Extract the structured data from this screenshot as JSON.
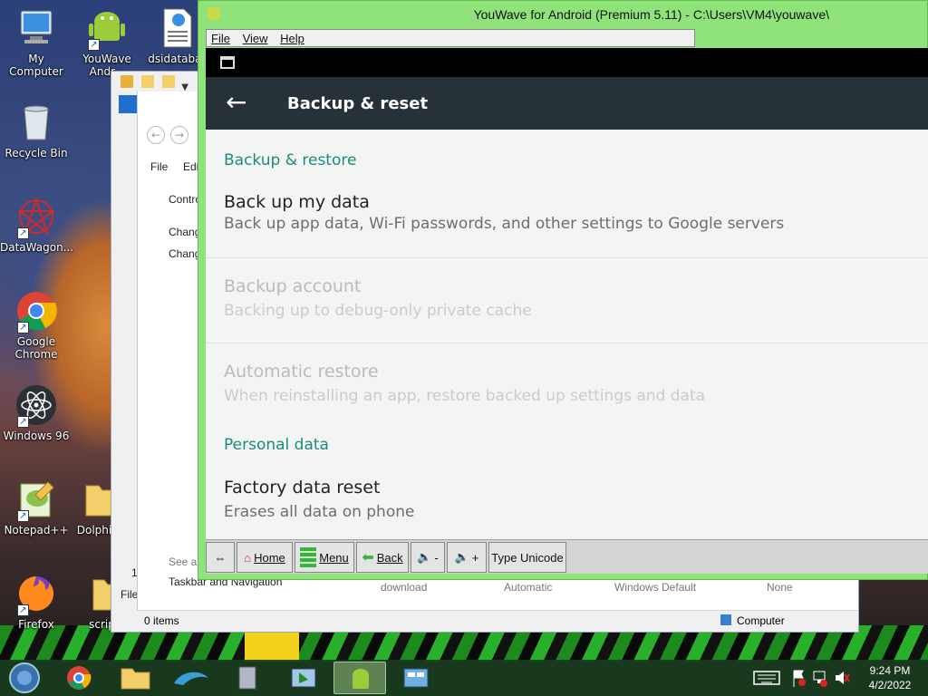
{
  "desktop": {
    "icons": [
      {
        "label": "My Computer"
      },
      {
        "label": "YouWave Andr..."
      },
      {
        "label": "dsidatabas"
      },
      {
        "label": "Recycle Bin"
      },
      {
        "label": "DataWagon..."
      },
      {
        "label": "Google Chrome"
      },
      {
        "label": "Windows 96"
      },
      {
        "label": "Notepad++"
      },
      {
        "label": "Dolphi"
      },
      {
        "label": "Firefox"
      },
      {
        "label": "scripts"
      }
    ]
  },
  "explorer": {
    "menu_file": "File",
    "menu_edit": "Edit",
    "left_file": "File",
    "item_control": "Contro",
    "item_change1": "Chang",
    "item_change2": "Chang",
    "see_also": "See als",
    "taskbar_nav": "Taskbar and Navigation",
    "row_values": [
      "download",
      "Automatic",
      "Windows Default",
      "None"
    ],
    "items_count": "0 items",
    "location": "Computer",
    "digit": "1"
  },
  "youwave": {
    "title": "YouWave for Android (Premium 5.11) - C:\\Users\\VM4\\youwave\\",
    "menu": {
      "file": "File",
      "view": "View",
      "help": "Help"
    },
    "screen": {
      "page_title": "Backup & reset",
      "section_backup": "Backup & restore",
      "section_personal": "Personal data",
      "prefs": [
        {
          "title": "Back up my data",
          "summary": "Back up app data, Wi-Fi passwords, and other settings to Google servers",
          "enabled": true
        },
        {
          "title": "Backup account",
          "summary": "Backing up to debug-only private cache",
          "enabled": false
        },
        {
          "title": "Automatic restore",
          "summary": "When reinstalling an app, restore backed up settings and data",
          "enabled": false
        },
        {
          "title": "Factory data reset",
          "summary": "Erases all data on phone",
          "enabled": true
        }
      ]
    },
    "toolbar": {
      "home": "Home",
      "menu": "Menu",
      "back": "Back",
      "vol_down": "-",
      "vol_up": "+",
      "type_unicode": "Type Unicode"
    }
  },
  "taskbar": {
    "time": "9:24 PM",
    "date": "4/2/2022"
  },
  "colors": {
    "youwave_frame": "#8fe37a",
    "appbar": "#263238",
    "accent_teal": "#1e8a7a"
  }
}
